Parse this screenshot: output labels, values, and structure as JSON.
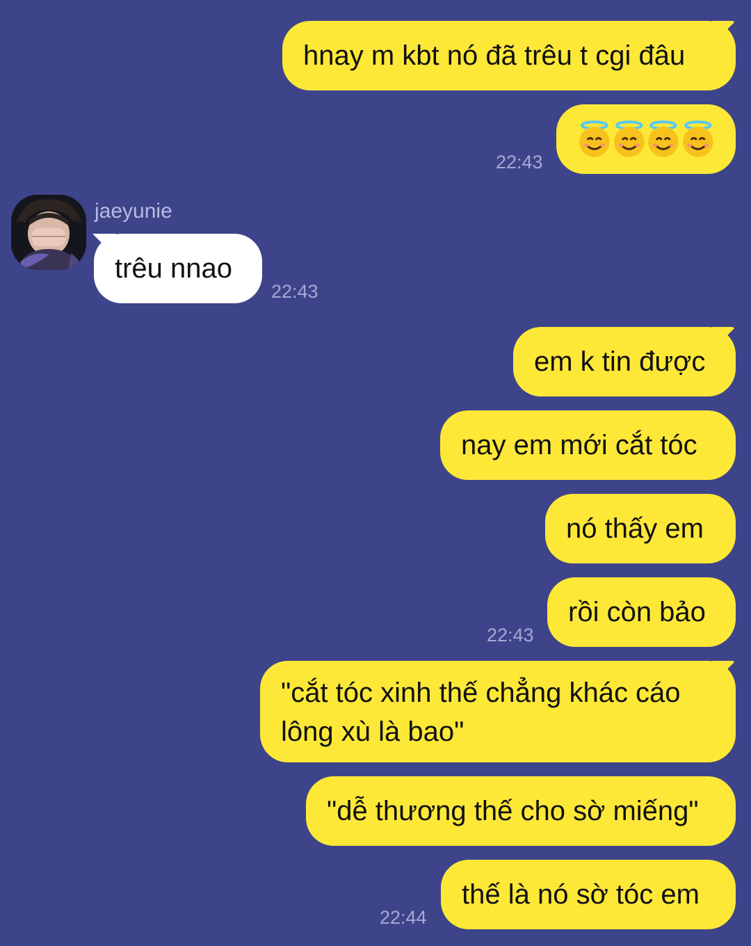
{
  "colors": {
    "background": "#3e4489",
    "outgoing_bubble": "#fde838",
    "incoming_bubble": "#ffffff",
    "timestamp": "#a5a9d6"
  },
  "contact": {
    "name": "jaeyunie",
    "avatar_icon": "profile-photo"
  },
  "messages": [
    {
      "id": "m1",
      "direction": "out",
      "text": "hnay m kbt nó đã trêu t cgi đâu"
    },
    {
      "id": "m2",
      "direction": "out",
      "emoji": [
        "smiling-face-with-halo",
        "smiling-face-with-halo",
        "smiling-face-with-halo",
        "smiling-face-with-halo"
      ],
      "text": "😇😇😇😇",
      "time": "22:43"
    },
    {
      "id": "m3",
      "direction": "in",
      "text": "trêu nnao",
      "time": "22:43"
    },
    {
      "id": "m4",
      "direction": "out",
      "text": "em k tin được"
    },
    {
      "id": "m5",
      "direction": "out",
      "text": "nay em mới cắt tóc"
    },
    {
      "id": "m6",
      "direction": "out",
      "text": "nó thấy em"
    },
    {
      "id": "m7",
      "direction": "out",
      "text": "rồi còn bảo",
      "time": "22:43"
    },
    {
      "id": "m8",
      "direction": "out",
      "line1": "\"cắt tóc xinh thế chẳng khác cáo",
      "line2": "lông xù là bao\""
    },
    {
      "id": "m9",
      "direction": "out",
      "text": "\"dễ thương thế cho sờ miếng\""
    },
    {
      "id": "m10",
      "direction": "out",
      "text": "thế là nó sờ tóc em",
      "time": "22:44"
    }
  ]
}
